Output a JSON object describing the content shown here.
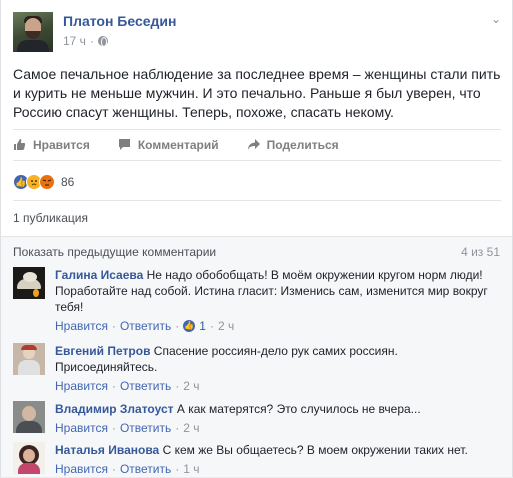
{
  "post": {
    "author": "Платон Беседин",
    "time": "17 ч",
    "separator": "·",
    "menu_icon": "chevron-down-icon",
    "text": "Самое печальное наблюдение за последнее время – женщины стали пить и курить не меньше мужчин. И это печально. Раньше я был уверен, что Россию спасут женщины. Теперь, похоже, спасать некому."
  },
  "actions": {
    "like": "Нравится",
    "comment": "Комментарий",
    "share": "Поделиться"
  },
  "reactions": {
    "types": [
      "like",
      "sad",
      "angry"
    ],
    "count": "86"
  },
  "shares": "1 публикация",
  "comments_section": {
    "previous_label": "Показать предыдущие комментарии",
    "pager": "4 из 51"
  },
  "comments": [
    {
      "name": "Галина Исаева",
      "text": "Не надо обобобщать! В моём окружении кругом норм люди! Поработайте над собой. Истина гласит: Изменись сам, изменится мир вокруг тебя!",
      "like": "Нравится",
      "reply": "Ответить",
      "likes": "1",
      "time": "2 ч"
    },
    {
      "name": "Евгений Петров",
      "text": "Спасение россиян-дело рук самих россиян. Присоединяйтесь.",
      "like": "Нравится",
      "reply": "Ответить",
      "time": "2 ч"
    },
    {
      "name": "Владимир Златоуст",
      "text": "А как матерятся? Это случилось не вчера...",
      "like": "Нравится",
      "reply": "Ответить",
      "time": "2 ч"
    },
    {
      "name": "Наталья Иванова",
      "text": "С кем же Вы общаетесь? В моем окружении таких нет.",
      "like": "Нравится",
      "reply": "Ответить",
      "time": "1 ч"
    }
  ],
  "colors": {
    "link": "#365899",
    "accent": "#4267b2",
    "muted": "#90949c"
  }
}
